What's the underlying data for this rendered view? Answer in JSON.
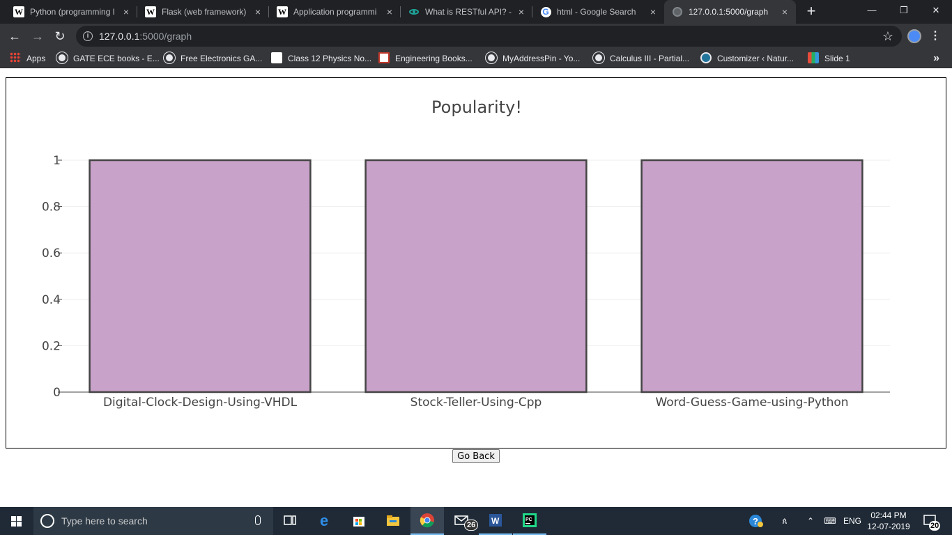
{
  "browser": {
    "tabs": [
      {
        "title": "Python (programming l",
        "favicon": "wikipedia-icon",
        "active": false
      },
      {
        "title": "Flask (web framework) -",
        "favicon": "wikipedia-icon",
        "active": false
      },
      {
        "title": "Application programmi",
        "favicon": "wikipedia-icon",
        "active": false
      },
      {
        "title": "What is RESTful API? - D",
        "favicon": "eye-icon",
        "active": false
      },
      {
        "title": "html - Google Search",
        "favicon": "google-icon",
        "active": false
      },
      {
        "title": "127.0.0.1:5000/graph",
        "favicon": "globe-icon",
        "active": true
      }
    ],
    "new_tab_label": "+",
    "close_glyph": "×",
    "window_controls": {
      "minimize": "—",
      "restore": "❐",
      "close": "✕"
    },
    "url_host": "127.0.0.1",
    "url_path": ":5000/graph",
    "bookmarks": [
      {
        "label": "Apps",
        "icon": "apps-grid-icon"
      },
      {
        "label": "GATE ECE books - E...",
        "icon": "globe-icon"
      },
      {
        "label": "Free Electronics GA...",
        "icon": "globe-icon"
      },
      {
        "label": "Class 12 Physics No...",
        "icon": "physics-icon"
      },
      {
        "label": "Engineering Books...",
        "icon": "books-icon"
      },
      {
        "label": "MyAddressPin - Yo...",
        "icon": "globe-icon"
      },
      {
        "label": "Calculus III - Partial...",
        "icon": "globe-icon"
      },
      {
        "label": "Customizer ‹ Natur...",
        "icon": "wordpress-icon"
      },
      {
        "label": "Slide 1",
        "icon": "slides-icon"
      }
    ],
    "bookmarks_more": "»"
  },
  "page": {
    "go_back_label": "Go Back"
  },
  "chart_data": {
    "type": "bar",
    "title": "Popularity!",
    "categories": [
      "Digital-Clock-Design-Using-VHDL",
      "Stock-Teller-Using-Cpp",
      "Word-Guess-Game-using-Python"
    ],
    "values": [
      1,
      1,
      1
    ],
    "ylim": [
      0,
      1
    ],
    "yticks": [
      0,
      0.2,
      0.4,
      0.6,
      0.8,
      1
    ],
    "ytick_labels": [
      "0",
      "0.2",
      "0.4",
      "0.6",
      "0.8",
      "1"
    ],
    "xlabel": "",
    "ylabel": "",
    "grid": true,
    "bar_color": "#c8a2c8",
    "bar_outline": "#444444"
  },
  "taskbar": {
    "search_placeholder": "Type here to search",
    "mail_badge": "26",
    "language": "ENG",
    "time": "02:44 PM",
    "date": "12-07-2019",
    "notification_count": "20"
  }
}
